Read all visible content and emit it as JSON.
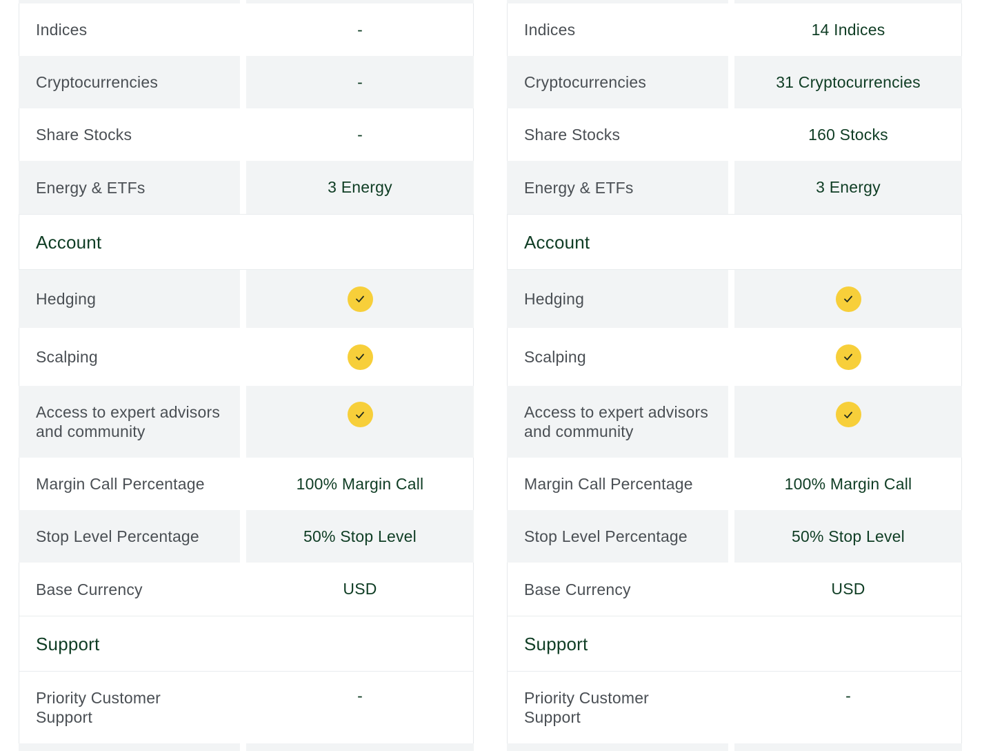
{
  "colors": {
    "accent": "#0f3d24",
    "check": "#f7cf3a",
    "shade": "#f2f4f5",
    "label": "#4a4f54"
  },
  "left": {
    "instruments": [
      {
        "label": "Indices",
        "value": "-"
      },
      {
        "label": "Cryptocurrencies",
        "value": "-"
      },
      {
        "label": "Share Stocks",
        "value": "-"
      },
      {
        "label": "Energy & ETFs",
        "value": "3 Energy"
      }
    ],
    "account_title": "Account",
    "account": [
      {
        "label": "Hedging",
        "icon": "check-icon"
      },
      {
        "label": "Scalping",
        "icon": "check-icon"
      },
      {
        "label": "Access to expert advisors and community",
        "icon": "check-icon"
      },
      {
        "label": "Margin Call Percentage",
        "value": "100% Margin Call"
      },
      {
        "label": "Stop Level Percentage",
        "value": "50% Stop Level"
      },
      {
        "label": "Base Currency",
        "value": "USD"
      }
    ],
    "support_title": "Support",
    "support": [
      {
        "label": "Priority Customer Support",
        "value": "-"
      }
    ]
  },
  "right": {
    "instruments": [
      {
        "label": "Indices",
        "value": "14 Indices"
      },
      {
        "label": "Cryptocurrencies",
        "value": "31 Cryptocurrencies"
      },
      {
        "label": "Share Stocks",
        "value": "160 Stocks"
      },
      {
        "label": "Energy & ETFs",
        "value": "3 Energy"
      }
    ],
    "account_title": "Account",
    "account": [
      {
        "label": "Hedging",
        "icon": "check-icon"
      },
      {
        "label": "Scalping",
        "icon": "check-icon"
      },
      {
        "label": "Access to expert advisors and community",
        "icon": "check-icon"
      },
      {
        "label": "Margin Call Percentage",
        "value": "100% Margin Call"
      },
      {
        "label": "Stop Level Percentage",
        "value": "50% Stop Level"
      },
      {
        "label": "Base Currency",
        "value": "USD"
      }
    ],
    "support_title": "Support",
    "support": [
      {
        "label": "Priority Customer Support",
        "value": "-"
      }
    ]
  }
}
